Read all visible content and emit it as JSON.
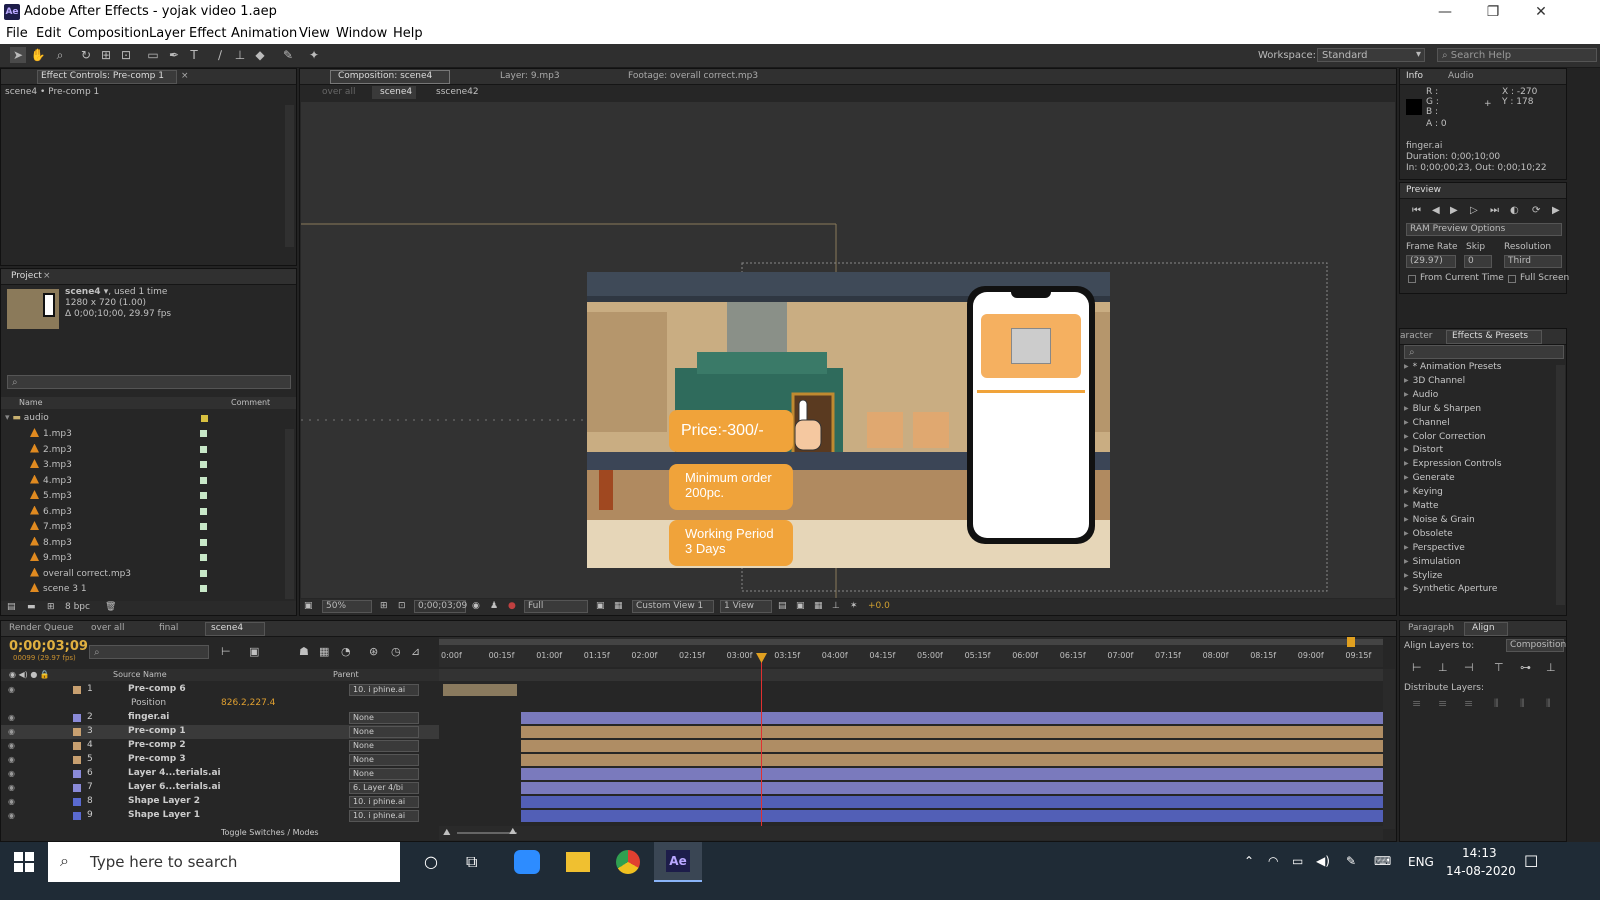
{
  "window": {
    "title": "Adobe After Effects - yojak video 1.aep",
    "app_icon": "Ae",
    "minimize": "—",
    "restore": "❐",
    "close": "✕"
  },
  "menu": [
    "File",
    "Edit",
    "Composition",
    "Layer",
    "Effect",
    "Animation",
    "View",
    "Window",
    "Help"
  ],
  "toolbar": {
    "workspace_label": "Workspace:",
    "workspace_value": "Standard",
    "search_placeholder": "Search Help"
  },
  "effect_controls": {
    "tab": "Effect Controls: Pre-comp 1",
    "breadcrumb": "scene4 • Pre-comp 1"
  },
  "project": {
    "tab": "Project",
    "item_name": "scene4 ▾",
    "item_used": ", used 1 time",
    "item_size": "1280 x 720 (1.00)",
    "item_duration": "Δ 0;00;10;00, 29.97 fps",
    "col_name": "Name",
    "col_comment": "Comment",
    "folder": "audio",
    "files": [
      "1.mp3",
      "2.mp3",
      "3.mp3",
      "4.mp3",
      "5.mp3",
      "6.mp3",
      "7.mp3",
      "8.mp3",
      "9.mp3",
      "overall correct.mp3",
      "scene 3 1"
    ],
    "bpc": "8 bpc"
  },
  "comp": {
    "tabs": [
      "Composition: scene4",
      "Layer: 9.mp3",
      "Footage: overall correct.mp3"
    ],
    "breadcrumbs": [
      "over all",
      "scene4",
      "sscene42"
    ],
    "zoom": "50%",
    "timecode": "0;00;03;09",
    "quality": "Full",
    "view": "Custom View 1",
    "views": "1 View",
    "exposure": "+0.0",
    "price": "Price:-300/-",
    "min_order": "Minimum order\n200pc.",
    "working_period": "Working Period\n3 Days"
  },
  "info": {
    "tabs": [
      "Info",
      "Audio"
    ],
    "r": "R :",
    "g": "G :",
    "b": "B :",
    "a": "A : 0",
    "x": "X : -270",
    "y": "Y : 178",
    "file": "finger.ai",
    "duration": "Duration: 0;00;10;00",
    "inout": "In: 0;00;00;23, Out: 0;00;10;22"
  },
  "preview": {
    "tab": "Preview",
    "ram_options": "RAM Preview Options",
    "frame_rate_label": "Frame Rate",
    "skip_label": "Skip",
    "resolution_label": "Resolution",
    "frame_rate": "(29.97)",
    "skip": "0",
    "resolution": "Third",
    "from_current": "From Current Time",
    "full_screen": "Full Screen"
  },
  "effects": {
    "tabs": [
      "aracter",
      "Effects & Presets"
    ],
    "items": [
      "* Animation Presets",
      "3D Channel",
      "Audio",
      "Blur & Sharpen",
      "Channel",
      "Color Correction",
      "Distort",
      "Expression Controls",
      "Generate",
      "Keying",
      "Matte",
      "Noise & Grain",
      "Obsolete",
      "Perspective",
      "Simulation",
      "Stylize",
      "Synthetic Aperture"
    ]
  },
  "align": {
    "tabs": [
      "Paragraph",
      "Align"
    ],
    "align_to_label": "Align Layers to:",
    "align_to": "Composition",
    "distribute_label": "Distribute Layers:"
  },
  "timeline": {
    "tabs": [
      "Render Queue",
      "over all",
      "final",
      "scene4"
    ],
    "timecode": "0;00;03;09",
    "frames": "00099 (29.97 fps)",
    "col_source": "Source Name",
    "col_parent": "Parent",
    "ruler": [
      "0:00f",
      "00:15f",
      "01:00f",
      "01:15f",
      "02:00f",
      "02:15f",
      "03:00f",
      "03:15f",
      "04:00f",
      "04:15f",
      "05:00f",
      "05:15f",
      "06:00f",
      "06:15f",
      "07:00f",
      "07:15f",
      "08:00f",
      "08:15f",
      "09:00f",
      "09:15f"
    ],
    "position_label": "Position",
    "position_value": "826.2,227.4",
    "toggle": "Toggle Switches / Modes",
    "layers": [
      {
        "num": "1",
        "name": "Pre-comp 6",
        "parent": "10. i phine.ai",
        "color": "#c8a070"
      },
      {
        "num": "2",
        "name": "finger.ai",
        "parent": "None",
        "color": "#8a8ad8"
      },
      {
        "num": "3",
        "name": "Pre-comp 1",
        "parent": "None",
        "color": "#c8a070"
      },
      {
        "num": "4",
        "name": "Pre-comp 2",
        "parent": "None",
        "color": "#c8a070"
      },
      {
        "num": "5",
        "name": "Pre-comp 3",
        "parent": "None",
        "color": "#c8a070"
      },
      {
        "num": "6",
        "name": "Layer 4...terials.ai",
        "parent": "None",
        "color": "#8a8ad8"
      },
      {
        "num": "7",
        "name": "Layer 6...terials.ai",
        "parent": "6. Layer 4/bi",
        "color": "#8a8ad8"
      },
      {
        "num": "8",
        "name": "Shape Layer 2",
        "parent": "10. i phine.ai",
        "color": "#5a6ad0"
      },
      {
        "num": "9",
        "name": "Shape Layer 1",
        "parent": "10. i phine.ai",
        "color": "#5a6ad0"
      }
    ]
  },
  "taskbar": {
    "search": "Type here to search",
    "lang": "ENG",
    "time": "14:13",
    "date": "14-08-2020"
  }
}
